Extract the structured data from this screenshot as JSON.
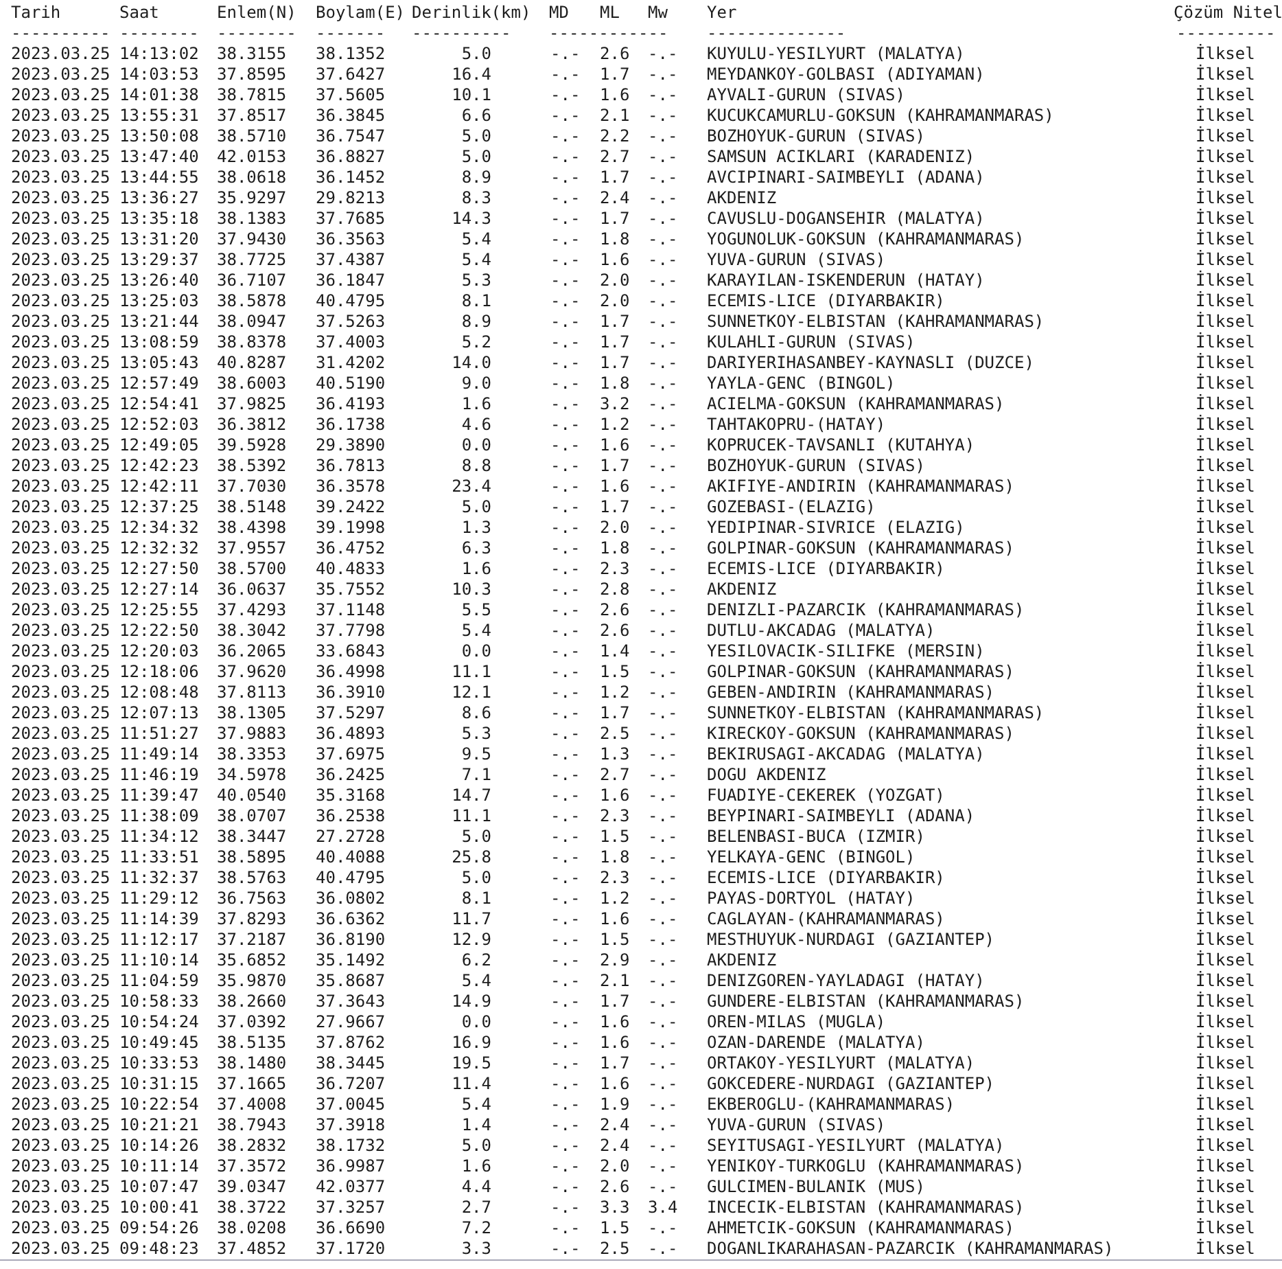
{
  "columns": [
    "Tarih",
    "Saat",
    "Enlem(N)",
    "Boylam(E)",
    "Derinlik(km)",
    "MD",
    "ML",
    "Mw",
    "Yer",
    "Çözüm Nitel"
  ],
  "underlines": [
    "----------",
    "--------",
    "--------",
    "-------",
    "----------",
    "------------",
    "--------------",
    "----------"
  ],
  "rows": [
    {
      "date": "2023.03.25",
      "time": "14:13:02",
      "lat": "38.3155",
      "lon": "38.1352",
      "depth": "5.0",
      "md": "-.-",
      "ml": "2.6",
      "mw": "-.-",
      "place": "KUYULU-YESILYURT (MALATYA)",
      "solution": "İlksel"
    },
    {
      "date": "2023.03.25",
      "time": "14:03:53",
      "lat": "37.8595",
      "lon": "37.6427",
      "depth": "16.4",
      "md": "-.-",
      "ml": "1.7",
      "mw": "-.-",
      "place": "MEYDANKOY-GOLBASI (ADIYAMAN)",
      "solution": "İlksel"
    },
    {
      "date": "2023.03.25",
      "time": "14:01:38",
      "lat": "38.7815",
      "lon": "37.5605",
      "depth": "10.1",
      "md": "-.-",
      "ml": "1.6",
      "mw": "-.-",
      "place": "AYVALI-GURUN (SIVAS)",
      "solution": "İlksel"
    },
    {
      "date": "2023.03.25",
      "time": "13:55:31",
      "lat": "37.8517",
      "lon": "36.3845",
      "depth": "6.6",
      "md": "-.-",
      "ml": "2.1",
      "mw": "-.-",
      "place": "KUCUKCAMURLU-GOKSUN (KAHRAMANMARAS)",
      "solution": "İlksel"
    },
    {
      "date": "2023.03.25",
      "time": "13:50:08",
      "lat": "38.5710",
      "lon": "36.7547",
      "depth": "5.0",
      "md": "-.-",
      "ml": "2.2",
      "mw": "-.-",
      "place": "BOZHOYUK-GURUN (SIVAS)",
      "solution": "İlksel"
    },
    {
      "date": "2023.03.25",
      "time": "13:47:40",
      "lat": "42.0153",
      "lon": "36.8827",
      "depth": "5.0",
      "md": "-.-",
      "ml": "2.7",
      "mw": "-.-",
      "place": "SAMSUN ACIKLARI (KARADENIZ)",
      "solution": "İlksel"
    },
    {
      "date": "2023.03.25",
      "time": "13:44:55",
      "lat": "38.0618",
      "lon": "36.1452",
      "depth": "8.9",
      "md": "-.-",
      "ml": "1.7",
      "mw": "-.-",
      "place": "AVCIPINARI-SAIMBEYLI (ADANA)",
      "solution": "İlksel"
    },
    {
      "date": "2023.03.25",
      "time": "13:36:27",
      "lat": "35.9297",
      "lon": "29.8213",
      "depth": "8.3",
      "md": "-.-",
      "ml": "2.4",
      "mw": "-.-",
      "place": "AKDENIZ",
      "solution": "İlksel"
    },
    {
      "date": "2023.03.25",
      "time": "13:35:18",
      "lat": "38.1383",
      "lon": "37.7685",
      "depth": "14.3",
      "md": "-.-",
      "ml": "1.7",
      "mw": "-.-",
      "place": "CAVUSLU-DOGANSEHIR (MALATYA)",
      "solution": "İlksel"
    },
    {
      "date": "2023.03.25",
      "time": "13:31:20",
      "lat": "37.9430",
      "lon": "36.3563",
      "depth": "5.4",
      "md": "-.-",
      "ml": "1.8",
      "mw": "-.-",
      "place": "YOGUNOLUK-GOKSUN (KAHRAMANMARAS)",
      "solution": "İlksel"
    },
    {
      "date": "2023.03.25",
      "time": "13:29:37",
      "lat": "38.7725",
      "lon": "37.4387",
      "depth": "5.4",
      "md": "-.-",
      "ml": "1.6",
      "mw": "-.-",
      "place": "YUVA-GURUN (SIVAS)",
      "solution": "İlksel"
    },
    {
      "date": "2023.03.25",
      "time": "13:26:40",
      "lat": "36.7107",
      "lon": "36.1847",
      "depth": "5.3",
      "md": "-.-",
      "ml": "2.0",
      "mw": "-.-",
      "place": "KARAYILAN-ISKENDERUN (HATAY)",
      "solution": "İlksel"
    },
    {
      "date": "2023.03.25",
      "time": "13:25:03",
      "lat": "38.5878",
      "lon": "40.4795",
      "depth": "8.1",
      "md": "-.-",
      "ml": "2.0",
      "mw": "-.-",
      "place": "ECEMIS-LICE (DIYARBAKIR)",
      "solution": "İlksel"
    },
    {
      "date": "2023.03.25",
      "time": "13:21:44",
      "lat": "38.0947",
      "lon": "37.5263",
      "depth": "8.9",
      "md": "-.-",
      "ml": "1.7",
      "mw": "-.-",
      "place": "SUNNETKOY-ELBISTAN (KAHRAMANMARAS)",
      "solution": "İlksel"
    },
    {
      "date": "2023.03.25",
      "time": "13:08:59",
      "lat": "38.8378",
      "lon": "37.4003",
      "depth": "5.2",
      "md": "-.-",
      "ml": "1.7",
      "mw": "-.-",
      "place": "KULAHLI-GURUN (SIVAS)",
      "solution": "İlksel"
    },
    {
      "date": "2023.03.25",
      "time": "13:05:43",
      "lat": "40.8287",
      "lon": "31.4202",
      "depth": "14.0",
      "md": "-.-",
      "ml": "1.7",
      "mw": "-.-",
      "place": "DARIYERIHASANBEY-KAYNASLI (DUZCE)",
      "solution": "İlksel"
    },
    {
      "date": "2023.03.25",
      "time": "12:57:49",
      "lat": "38.6003",
      "lon": "40.5190",
      "depth": "9.0",
      "md": "-.-",
      "ml": "1.8",
      "mw": "-.-",
      "place": "YAYLA-GENC (BINGOL)",
      "solution": "İlksel"
    },
    {
      "date": "2023.03.25",
      "time": "12:54:41",
      "lat": "37.9825",
      "lon": "36.4193",
      "depth": "1.6",
      "md": "-.-",
      "ml": "3.2",
      "mw": "-.-",
      "place": "ACIELMA-GOKSUN (KAHRAMANMARAS)",
      "solution": "İlksel"
    },
    {
      "date": "2023.03.25",
      "time": "12:52:03",
      "lat": "36.3812",
      "lon": "36.1738",
      "depth": "4.6",
      "md": "-.-",
      "ml": "1.2",
      "mw": "-.-",
      "place": "TAHTAKOPRU-(HATAY)",
      "solution": "İlksel"
    },
    {
      "date": "2023.03.25",
      "time": "12:49:05",
      "lat": "39.5928",
      "lon": "29.3890",
      "depth": "0.0",
      "md": "-.-",
      "ml": "1.6",
      "mw": "-.-",
      "place": "KOPRUCEK-TAVSANLI (KUTAHYA)",
      "solution": "İlksel"
    },
    {
      "date": "2023.03.25",
      "time": "12:42:23",
      "lat": "38.5392",
      "lon": "36.7813",
      "depth": "8.8",
      "md": "-.-",
      "ml": "1.7",
      "mw": "-.-",
      "place": "BOZHOYUK-GURUN (SIVAS)",
      "solution": "İlksel"
    },
    {
      "date": "2023.03.25",
      "time": "12:42:11",
      "lat": "37.7030",
      "lon": "36.3578",
      "depth": "23.4",
      "md": "-.-",
      "ml": "1.6",
      "mw": "-.-",
      "place": "AKIFIYE-ANDIRIN (KAHRAMANMARAS)",
      "solution": "İlksel"
    },
    {
      "date": "2023.03.25",
      "time": "12:37:25",
      "lat": "38.5148",
      "lon": "39.2422",
      "depth": "5.0",
      "md": "-.-",
      "ml": "1.7",
      "mw": "-.-",
      "place": "GOZEBASI-(ELAZIG)",
      "solution": "İlksel"
    },
    {
      "date": "2023.03.25",
      "time": "12:34:32",
      "lat": "38.4398",
      "lon": "39.1998",
      "depth": "1.3",
      "md": "-.-",
      "ml": "2.0",
      "mw": "-.-",
      "place": "YEDIPINAR-SIVRICE (ELAZIG)",
      "solution": "İlksel"
    },
    {
      "date": "2023.03.25",
      "time": "12:32:32",
      "lat": "37.9557",
      "lon": "36.4752",
      "depth": "6.3",
      "md": "-.-",
      "ml": "1.8",
      "mw": "-.-",
      "place": "GOLPINAR-GOKSUN (KAHRAMANMARAS)",
      "solution": "İlksel"
    },
    {
      "date": "2023.03.25",
      "time": "12:27:50",
      "lat": "38.5700",
      "lon": "40.4833",
      "depth": "1.6",
      "md": "-.-",
      "ml": "2.3",
      "mw": "-.-",
      "place": "ECEMIS-LICE (DIYARBAKIR)",
      "solution": "İlksel"
    },
    {
      "date": "2023.03.25",
      "time": "12:27:14",
      "lat": "36.0637",
      "lon": "35.7552",
      "depth": "10.3",
      "md": "-.-",
      "ml": "2.8",
      "mw": "-.-",
      "place": "AKDENIZ",
      "solution": "İlksel"
    },
    {
      "date": "2023.03.25",
      "time": "12:25:55",
      "lat": "37.4293",
      "lon": "37.1148",
      "depth": "5.5",
      "md": "-.-",
      "ml": "2.6",
      "mw": "-.-",
      "place": "DENIZLI-PAZARCIK (KAHRAMANMARAS)",
      "solution": "İlksel"
    },
    {
      "date": "2023.03.25",
      "time": "12:22:50",
      "lat": "38.3042",
      "lon": "37.7798",
      "depth": "5.4",
      "md": "-.-",
      "ml": "2.6",
      "mw": "-.-",
      "place": "DUTLU-AKCADAG (MALATYA)",
      "solution": "İlksel"
    },
    {
      "date": "2023.03.25",
      "time": "12:20:03",
      "lat": "36.2065",
      "lon": "33.6843",
      "depth": "0.0",
      "md": "-.-",
      "ml": "1.4",
      "mw": "-.-",
      "place": "YESILOVACIK-SILIFKE (MERSIN)",
      "solution": "İlksel"
    },
    {
      "date": "2023.03.25",
      "time": "12:18:06",
      "lat": "37.9620",
      "lon": "36.4998",
      "depth": "11.1",
      "md": "-.-",
      "ml": "1.5",
      "mw": "-.-",
      "place": "GOLPINAR-GOKSUN (KAHRAMANMARAS)",
      "solution": "İlksel"
    },
    {
      "date": "2023.03.25",
      "time": "12:08:48",
      "lat": "37.8113",
      "lon": "36.3910",
      "depth": "12.1",
      "md": "-.-",
      "ml": "1.2",
      "mw": "-.-",
      "place": "GEBEN-ANDIRIN (KAHRAMANMARAS)",
      "solution": "İlksel"
    },
    {
      "date": "2023.03.25",
      "time": "12:07:13",
      "lat": "38.1305",
      "lon": "37.5297",
      "depth": "8.6",
      "md": "-.-",
      "ml": "1.7",
      "mw": "-.-",
      "place": "SUNNETKOY-ELBISTAN (KAHRAMANMARAS)",
      "solution": "İlksel"
    },
    {
      "date": "2023.03.25",
      "time": "11:51:27",
      "lat": "37.9883",
      "lon": "36.4893",
      "depth": "5.3",
      "md": "-.-",
      "ml": "2.5",
      "mw": "-.-",
      "place": "KIRECKOY-GOKSUN (KAHRAMANMARAS)",
      "solution": "İlksel"
    },
    {
      "date": "2023.03.25",
      "time": "11:49:14",
      "lat": "38.3353",
      "lon": "37.6975",
      "depth": "9.5",
      "md": "-.-",
      "ml": "1.3",
      "mw": "-.-",
      "place": "BEKIRUSAGI-AKCADAG (MALATYA)",
      "solution": "İlksel"
    },
    {
      "date": "2023.03.25",
      "time": "11:46:19",
      "lat": "34.5978",
      "lon": "36.2425",
      "depth": "7.1",
      "md": "-.-",
      "ml": "2.7",
      "mw": "-.-",
      "place": "DOGU AKDENIZ",
      "solution": "İlksel"
    },
    {
      "date": "2023.03.25",
      "time": "11:39:47",
      "lat": "40.0540",
      "lon": "35.3168",
      "depth": "14.7",
      "md": "-.-",
      "ml": "1.6",
      "mw": "-.-",
      "place": "FUADIYE-CEKEREK (YOZGAT)",
      "solution": "İlksel"
    },
    {
      "date": "2023.03.25",
      "time": "11:38:09",
      "lat": "38.0707",
      "lon": "36.2538",
      "depth": "11.1",
      "md": "-.-",
      "ml": "2.3",
      "mw": "-.-",
      "place": "BEYPINARI-SAIMBEYLI (ADANA)",
      "solution": "İlksel"
    },
    {
      "date": "2023.03.25",
      "time": "11:34:12",
      "lat": "38.3447",
      "lon": "27.2728",
      "depth": "5.0",
      "md": "-.-",
      "ml": "1.5",
      "mw": "-.-",
      "place": "BELENBASI-BUCA (IZMIR)",
      "solution": "İlksel"
    },
    {
      "date": "2023.03.25",
      "time": "11:33:51",
      "lat": "38.5895",
      "lon": "40.4088",
      "depth": "25.8",
      "md": "-.-",
      "ml": "1.8",
      "mw": "-.-",
      "place": "YELKAYA-GENC (BINGOL)",
      "solution": "İlksel"
    },
    {
      "date": "2023.03.25",
      "time": "11:32:37",
      "lat": "38.5763",
      "lon": "40.4795",
      "depth": "5.0",
      "md": "-.-",
      "ml": "2.3",
      "mw": "-.-",
      "place": "ECEMIS-LICE (DIYARBAKIR)",
      "solution": "İlksel"
    },
    {
      "date": "2023.03.25",
      "time": "11:29:12",
      "lat": "36.7563",
      "lon": "36.0802",
      "depth": "8.1",
      "md": "-.-",
      "ml": "1.2",
      "mw": "-.-",
      "place": "PAYAS-DORTYOL (HATAY)",
      "solution": "İlksel"
    },
    {
      "date": "2023.03.25",
      "time": "11:14:39",
      "lat": "37.8293",
      "lon": "36.6362",
      "depth": "11.7",
      "md": "-.-",
      "ml": "1.6",
      "mw": "-.-",
      "place": "CAGLAYAN-(KAHRAMANMARAS)",
      "solution": "İlksel"
    },
    {
      "date": "2023.03.25",
      "time": "11:12:17",
      "lat": "37.2187",
      "lon": "36.8190",
      "depth": "12.9",
      "md": "-.-",
      "ml": "1.5",
      "mw": "-.-",
      "place": "MESTHUYUK-NURDAGI (GAZIANTEP)",
      "solution": "İlksel"
    },
    {
      "date": "2023.03.25",
      "time": "11:10:14",
      "lat": "35.6852",
      "lon": "35.1492",
      "depth": "6.2",
      "md": "-.-",
      "ml": "2.9",
      "mw": "-.-",
      "place": "AKDENIZ",
      "solution": "İlksel"
    },
    {
      "date": "2023.03.25",
      "time": "11:04:59",
      "lat": "35.9870",
      "lon": "35.8687",
      "depth": "5.4",
      "md": "-.-",
      "ml": "2.1",
      "mw": "-.-",
      "place": "DENIZGOREN-YAYLADAGI (HATAY)",
      "solution": "İlksel"
    },
    {
      "date": "2023.03.25",
      "time": "10:58:33",
      "lat": "38.2660",
      "lon": "37.3643",
      "depth": "14.9",
      "md": "-.-",
      "ml": "1.7",
      "mw": "-.-",
      "place": "GUNDERE-ELBISTAN (KAHRAMANMARAS)",
      "solution": "İlksel"
    },
    {
      "date": "2023.03.25",
      "time": "10:54:24",
      "lat": "37.0392",
      "lon": "27.9667",
      "depth": "0.0",
      "md": "-.-",
      "ml": "1.6",
      "mw": "-.-",
      "place": "OREN-MILAS (MUGLA)",
      "solution": "İlksel"
    },
    {
      "date": "2023.03.25",
      "time": "10:49:45",
      "lat": "38.5135",
      "lon": "37.8762",
      "depth": "16.9",
      "md": "-.-",
      "ml": "1.6",
      "mw": "-.-",
      "place": "OZAN-DARENDE (MALATYA)",
      "solution": "İlksel"
    },
    {
      "date": "2023.03.25",
      "time": "10:33:53",
      "lat": "38.1480",
      "lon": "38.3445",
      "depth": "19.5",
      "md": "-.-",
      "ml": "1.7",
      "mw": "-.-",
      "place": "ORTAKOY-YESILYURT (MALATYA)",
      "solution": "İlksel"
    },
    {
      "date": "2023.03.25",
      "time": "10:31:15",
      "lat": "37.1665",
      "lon": "36.7207",
      "depth": "11.4",
      "md": "-.-",
      "ml": "1.6",
      "mw": "-.-",
      "place": "GOKCEDERE-NURDAGI (GAZIANTEP)",
      "solution": "İlksel"
    },
    {
      "date": "2023.03.25",
      "time": "10:22:54",
      "lat": "37.4008",
      "lon": "37.0045",
      "depth": "5.4",
      "md": "-.-",
      "ml": "1.9",
      "mw": "-.-",
      "place": "EKBEROGLU-(KAHRAMANMARAS)",
      "solution": "İlksel"
    },
    {
      "date": "2023.03.25",
      "time": "10:21:21",
      "lat": "38.7943",
      "lon": "37.3918",
      "depth": "1.4",
      "md": "-.-",
      "ml": "2.4",
      "mw": "-.-",
      "place": "YUVA-GURUN (SIVAS)",
      "solution": "İlksel"
    },
    {
      "date": "2023.03.25",
      "time": "10:14:26",
      "lat": "38.2832",
      "lon": "38.1732",
      "depth": "5.0",
      "md": "-.-",
      "ml": "2.4",
      "mw": "-.-",
      "place": "SEYITUSAGI-YESILYURT (MALATYA)",
      "solution": "İlksel"
    },
    {
      "date": "2023.03.25",
      "time": "10:11:14",
      "lat": "37.3572",
      "lon": "36.9987",
      "depth": "1.6",
      "md": "-.-",
      "ml": "2.0",
      "mw": "-.-",
      "place": "YENIKOY-TURKOGLU (KAHRAMANMARAS)",
      "solution": "İlksel"
    },
    {
      "date": "2023.03.25",
      "time": "10:07:47",
      "lat": "39.0347",
      "lon": "42.0377",
      "depth": "4.4",
      "md": "-.-",
      "ml": "2.6",
      "mw": "-.-",
      "place": "GULCIMEN-BULANIK (MUS)",
      "solution": "İlksel"
    },
    {
      "date": "2023.03.25",
      "time": "10:00:41",
      "lat": "38.3722",
      "lon": "37.3257",
      "depth": "2.7",
      "md": "-.-",
      "ml": "3.3",
      "mw": "3.4",
      "place": "INCECIK-ELBISTAN (KAHRAMANMARAS)",
      "solution": "İlksel"
    },
    {
      "date": "2023.03.25",
      "time": "09:54:26",
      "lat": "38.0208",
      "lon": "36.6690",
      "depth": "7.2",
      "md": "-.-",
      "ml": "1.5",
      "mw": "-.-",
      "place": "AHMETCIK-GOKSUN (KAHRAMANMARAS)",
      "solution": "İlksel"
    },
    {
      "date": "2023.03.25",
      "time": "09:48:23",
      "lat": "37.4852",
      "lon": "37.1720",
      "depth": "3.3",
      "md": "-.-",
      "ml": "2.5",
      "mw": "-.-",
      "place": "DOGANLIKARAHASAN-PAZARCIK (KAHRAMANMARAS)",
      "solution": "İlksel"
    }
  ]
}
